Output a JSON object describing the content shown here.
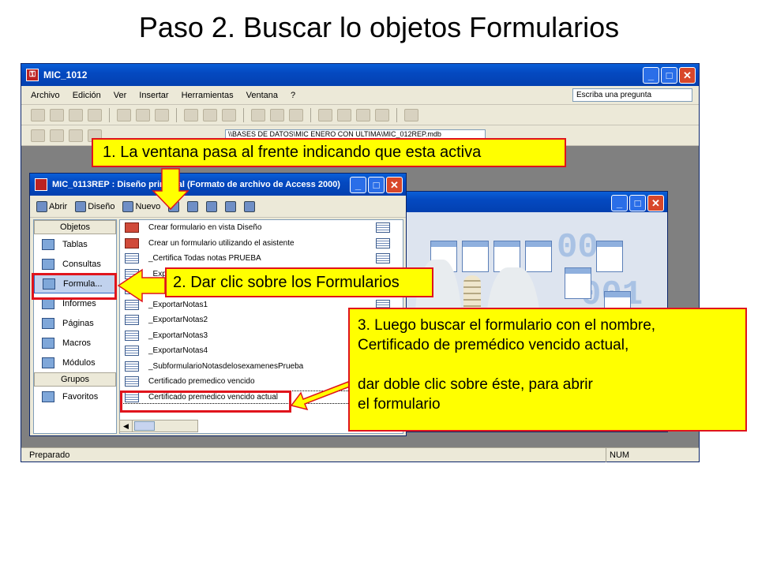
{
  "slide": {
    "title": "Paso 2. Buscar lo objetos Formularios"
  },
  "main_window": {
    "title": "MIC_1012",
    "menu": [
      "Archivo",
      "Edición",
      "Ver",
      "Insertar",
      "Herramientas",
      "Ventana",
      "?"
    ],
    "ask_placeholder": "Escriba una pregunta",
    "path_text": "\\\\BASES DE DATOS\\MIC ENERO CON ULTIMA\\MIC_012REP.mdb",
    "status": "Preparado",
    "status_num": "NUM"
  },
  "db_window": {
    "title": "MIC_0113REP : Diseño principal (Formato de archivo de Access 2000)",
    "toolbar": {
      "open": "Abrir",
      "design": "Diseño",
      "new": "Nuevo"
    },
    "objects_header": "Objetos",
    "objects": [
      {
        "label": "Tablas"
      },
      {
        "label": "Consultas"
      },
      {
        "label": "Formula..."
      },
      {
        "label": "Informes"
      },
      {
        "label": "Páginas"
      },
      {
        "label": "Macros"
      },
      {
        "label": "Módulos"
      }
    ],
    "groups_header": "Grupos",
    "groups": [
      {
        "label": "Favoritos"
      }
    ],
    "forms": [
      "Crear formulario en vista Diseño",
      "Crear un formulario utilizando el asistente",
      "_Certifica Todas notas PRUEBA",
      "_Exp",
      "_Exp",
      "_ExportarNotas1",
      "_ExportarNotas2",
      "_ExportarNotas3",
      "_ExportarNotas4",
      "_SubformularioNotasdelosexamenesPrueba",
      "Certificado premedico vencido",
      "Certificado premedico vencido actual"
    ]
  },
  "callouts": {
    "c1": "1. La ventana pasa al frente indicando que esta activa",
    "c2": "2. Dar clic sobre los Formularios",
    "c3": "3. Luego buscar el formulario con el nombre,\nCertificado de premédico vencido actual,\n\ndar doble clic sobre éste, para abrir\nel formulario"
  },
  "colors": {
    "callout_fill": "#ffff00",
    "callout_border": "#e0141c",
    "titlebar": "#0449c0"
  }
}
